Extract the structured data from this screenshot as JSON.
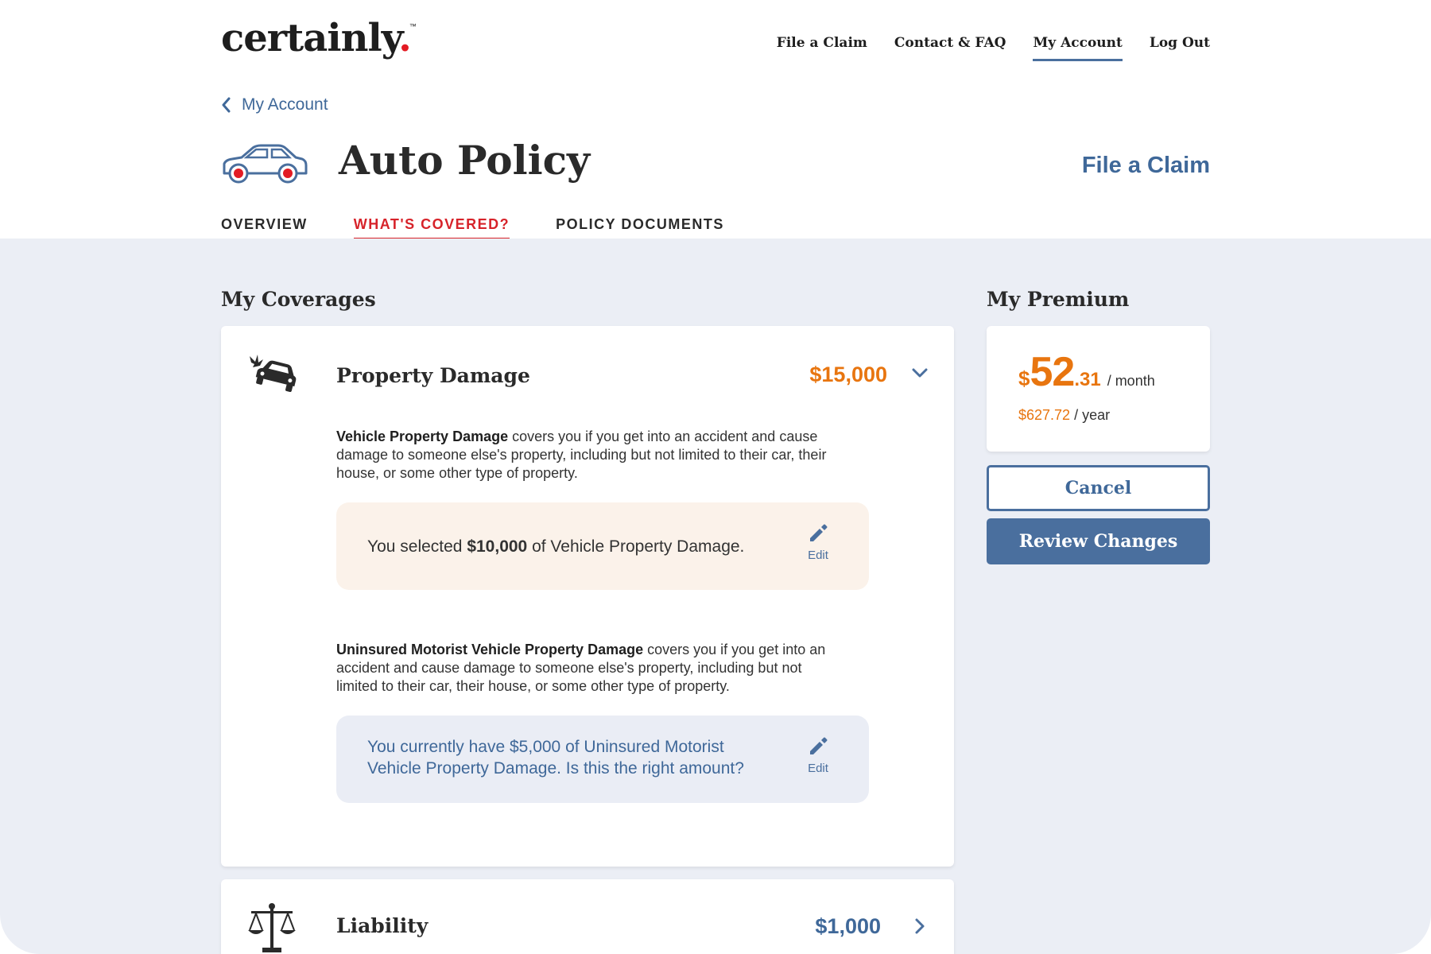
{
  "header": {
    "logo_text": "certainly",
    "logo_dot": ".",
    "logo_tm": "™",
    "nav": [
      {
        "label": "File a Claim"
      },
      {
        "label": "Contact & FAQ"
      },
      {
        "label": "My Account",
        "active": true
      },
      {
        "label": "Log Out"
      }
    ]
  },
  "breadcrumb": {
    "back_label": "My Account"
  },
  "page": {
    "title": "Auto Policy",
    "file_claim_label": "File a Claim",
    "tabs": [
      {
        "label": "OVERVIEW"
      },
      {
        "label": "WHAT'S COVERED?",
        "active": true
      },
      {
        "label": "POLICY DOCUMENTS"
      }
    ]
  },
  "coverages": {
    "section_title": "My Coverages",
    "property_damage": {
      "name": "Property Damage",
      "amount": "$15,000",
      "vpd": {
        "term": "Vehicle Property Damage",
        "description": " covers you if you get into an accident and cause damage to someone else's property, including but not limited to their car, their house, or some other type of property.",
        "callout_prefix": "You selected ",
        "callout_amount": "$10,000",
        "callout_suffix": " of Vehicle Property Damage.",
        "edit_label": "Edit"
      },
      "umvpd": {
        "term": "Uninsured Motorist Vehicle Property Damage",
        "description": " covers you if you get into an accident and cause damage to someone else's property, including but not limited to their car, their house, or some other type of property.",
        "callout_text": "You currently have $5,000 of Uninsured Motorist Vehicle Property Damage. Is this the right amount?",
        "edit_label": "Edit"
      }
    },
    "liability": {
      "name": "Liability",
      "amount": "$1,000"
    }
  },
  "premium": {
    "section_title": "My Premium",
    "currency": "$",
    "monthly_whole": "52",
    "monthly_cents": ".31",
    "monthly_unit": "/ month",
    "yearly_amount": "$627.72",
    "yearly_unit": "/ year",
    "cancel_label": "Cancel",
    "review_label": "Review Changes"
  },
  "colors": {
    "brand_blue": "#4a6f9e",
    "accent_orange": "#e8750f",
    "accent_red": "#d7232a",
    "background": "#ebeef5"
  }
}
